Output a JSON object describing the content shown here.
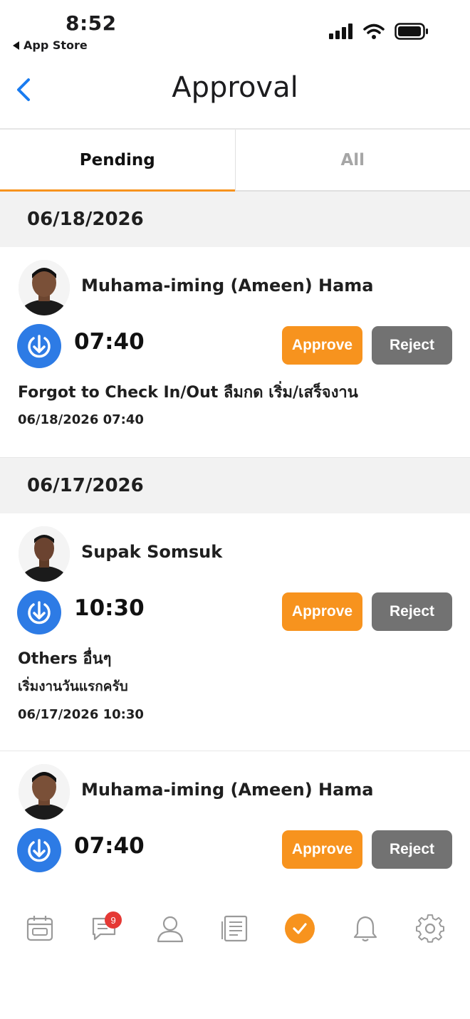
{
  "status_bar": {
    "time": "8:52",
    "back_app": "App Store"
  },
  "nav": {
    "title": "Approval"
  },
  "tabs": [
    {
      "label": "Pending",
      "active": true
    },
    {
      "label": "All",
      "active": false
    }
  ],
  "groups": [
    {
      "date": "06/18/2026",
      "requests": [
        {
          "name": "Muhama-iming (Ameen) Hama",
          "time": "07:40",
          "approve_label": "Approve",
          "reject_label": "Reject",
          "reason": "Forgot to Check In/Out ลืมกด เริ่ม/เสร็จงาน",
          "note": "",
          "timestamp": "06/18/2026 07:40"
        }
      ]
    },
    {
      "date": "06/17/2026",
      "requests": [
        {
          "name": "Supak Somsuk",
          "time": "10:30",
          "approve_label": "Approve",
          "reject_label": "Reject",
          "reason": "Others อื่นๆ",
          "note": "เริ่มงานวันแรกครับ",
          "timestamp": "06/17/2026 10:30"
        },
        {
          "name": "Muhama-iming (Ameen) Hama",
          "time": "07:40",
          "approve_label": "Approve",
          "reject_label": "Reject"
        }
      ]
    }
  ],
  "tab_bar": {
    "items": [
      {
        "icon": "calendar-icon"
      },
      {
        "icon": "chat-icon",
        "badge": "9"
      },
      {
        "icon": "profile-icon"
      },
      {
        "icon": "document-icon"
      },
      {
        "icon": "approval-check-icon",
        "active": true
      },
      {
        "icon": "bell-icon"
      },
      {
        "icon": "gear-icon"
      }
    ]
  },
  "colors": {
    "accent": "#f7931e",
    "reject": "#727272",
    "checkin_blue": "#2d7be5",
    "back_blue": "#1a7cf0",
    "badge": "#e53935"
  }
}
